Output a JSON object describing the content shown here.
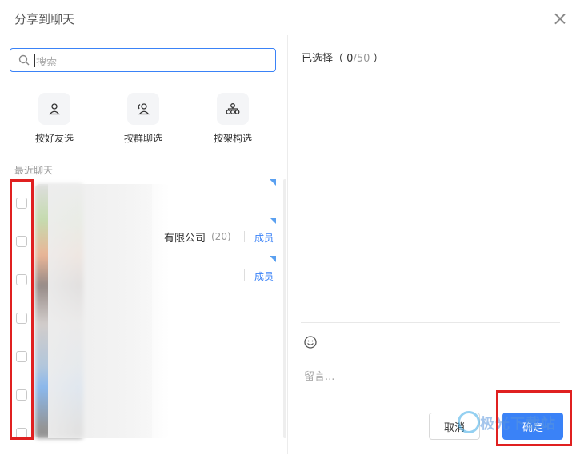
{
  "dialog": {
    "title": "分享到聊天"
  },
  "search": {
    "placeholder": "搜索"
  },
  "filters": [
    {
      "label": "按好友选",
      "icon": "person-icon"
    },
    {
      "label": "按群聊选",
      "icon": "group-chat-icon"
    },
    {
      "label": "按架构选",
      "icon": "org-structure-icon"
    }
  ],
  "recent": {
    "section_label": "最近聊天",
    "rows": [
      {
        "name_tail": "",
        "count": "",
        "member_link": ""
      },
      {
        "name_tail": "有限公司",
        "count": "(20)",
        "member_link": "成员"
      },
      {
        "name_tail": "",
        "count": "",
        "member_link": "成员"
      },
      {
        "name_tail": "",
        "count": "",
        "member_link": ""
      },
      {
        "name_tail": "",
        "count": "",
        "member_link": ""
      },
      {
        "name_tail": "",
        "count": "",
        "member_link": ""
      },
      {
        "name_tail": "",
        "count": "",
        "member_link": ""
      }
    ]
  },
  "selected": {
    "label": "已选择",
    "count": "0",
    "max": "/50"
  },
  "message": {
    "placeholder": "留言..."
  },
  "buttons": {
    "cancel": "取消",
    "confirm": "确定"
  },
  "watermark": {
    "text": "极光下载站"
  },
  "colors": {
    "accent": "#3a82f7",
    "highlight": "#e02020"
  }
}
